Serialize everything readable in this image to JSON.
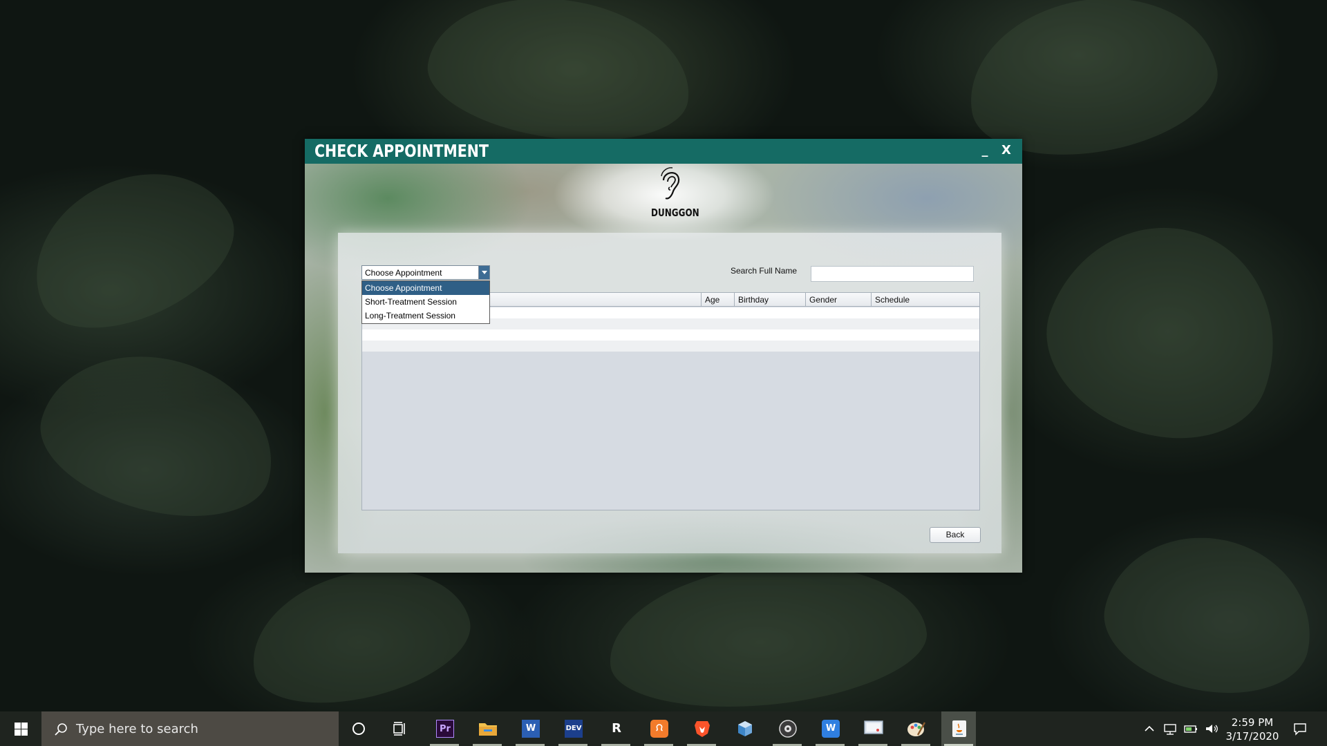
{
  "window": {
    "title": "CHECK APPOINTMENT",
    "minimize_label": "_",
    "close_label": "X",
    "accent_color": "#156b64"
  },
  "logo": {
    "text": "DUNGGON",
    "icon": "ear-icon"
  },
  "appointment_combo": {
    "selected": "Choose Appointment",
    "options": [
      "Choose Appointment",
      "Short-Treatment Session",
      "Long-Treatment Session"
    ],
    "highlighted_index": 0
  },
  "search": {
    "label": "Search Full Name",
    "value": ""
  },
  "table": {
    "columns": [
      "Age",
      "Birthday",
      "Gender",
      "Schedule"
    ],
    "rows": []
  },
  "back_button": {
    "label": "Back"
  },
  "taskbar": {
    "search_placeholder": "Type here to search",
    "apps": [
      {
        "name": "cortana-icon",
        "label": ""
      },
      {
        "name": "task-view-icon",
        "label": ""
      },
      {
        "name": "premiere-pro-icon",
        "label": "Pr"
      },
      {
        "name": "file-explorer-icon",
        "label": ""
      },
      {
        "name": "word-icon",
        "label": "W"
      },
      {
        "name": "dev-cpp-icon",
        "label": "DEV"
      },
      {
        "name": "jasper-report-icon",
        "label": "R"
      },
      {
        "name": "xampp-icon",
        "label": "ᙁ"
      },
      {
        "name": "brave-icon",
        "label": ""
      },
      {
        "name": "virtualbox-icon",
        "label": ""
      },
      {
        "name": "obs-icon",
        "label": ""
      },
      {
        "name": "wps-writer-icon",
        "label": "W"
      },
      {
        "name": "screen-app-icon",
        "label": ""
      },
      {
        "name": "paint-icon",
        "label": ""
      },
      {
        "name": "java-icon",
        "label": ""
      }
    ],
    "time": "2:59 PM",
    "date": "3/17/2020"
  }
}
